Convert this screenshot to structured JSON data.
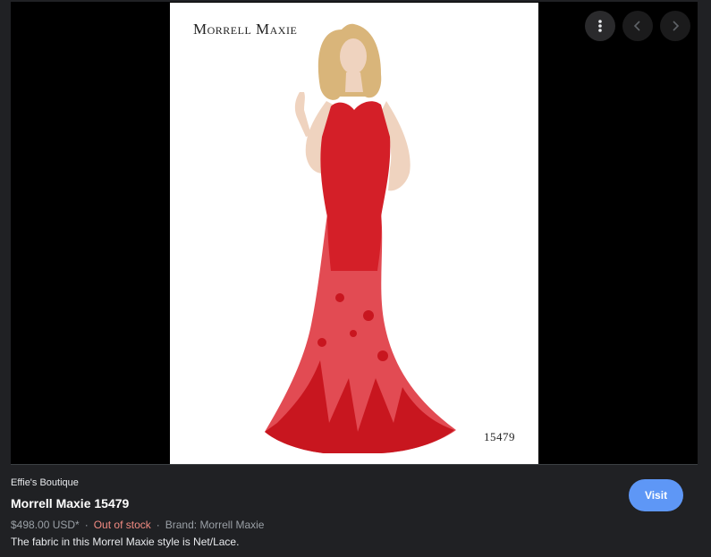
{
  "image": {
    "brand_logo_text": "Morrell Maxie",
    "style_number": "15479",
    "dress_color": "#d41f28",
    "background_color": "#ffffff"
  },
  "controls": {
    "more_icon": "more-vert-icon",
    "prev_icon": "chevron-left-icon",
    "next_icon": "chevron-right-icon"
  },
  "product": {
    "merchant": "Effie's Boutique",
    "title": "Morrell Maxie 15479",
    "price": "$498.00 USD*",
    "separator": "·",
    "stock_status": "Out of stock",
    "brand": "Brand: Morrell Maxie",
    "description": "The fabric in this Morrel Maxie style is Net/Lace."
  },
  "actions": {
    "visit_label": "Visit"
  },
  "colors": {
    "panel_bg": "#202124",
    "stock_red": "#f28b82",
    "visit_blue": "#5e97f6"
  }
}
